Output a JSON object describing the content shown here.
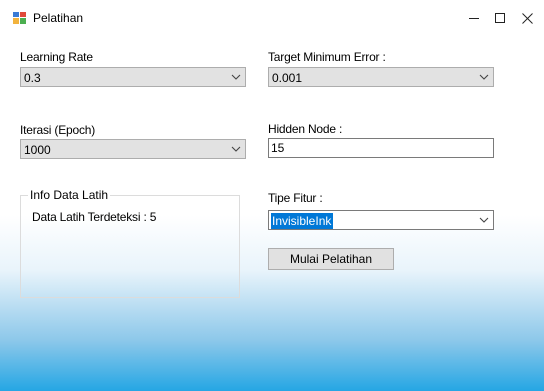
{
  "window": {
    "title": "Pelatihan"
  },
  "learning_rate": {
    "label": "Learning Rate",
    "value": "0.3"
  },
  "target_min_error": {
    "label": "Target Minimum Error :",
    "value": "0.001"
  },
  "iterasi": {
    "label": "Iterasi (Epoch)",
    "value": "1000"
  },
  "hidden_node": {
    "label": "Hidden Node :",
    "value": "15"
  },
  "info_group": {
    "title": "Info Data Latih",
    "text": "Data Latih Terdeteksi : 5"
  },
  "tipe_fitur": {
    "label": "Tipe Fitur :",
    "value": "InvisibleInk"
  },
  "start_button": {
    "label": "Mulai Pelatihan"
  },
  "colors": {
    "selection": "#0078d7",
    "gradient_bottom": "#25a6e4"
  },
  "icons": {
    "app": "app-icon",
    "minimize": "minimize-icon",
    "maximize": "maximize-icon",
    "close": "close-icon",
    "dropdown": "chevron-down-icon"
  }
}
